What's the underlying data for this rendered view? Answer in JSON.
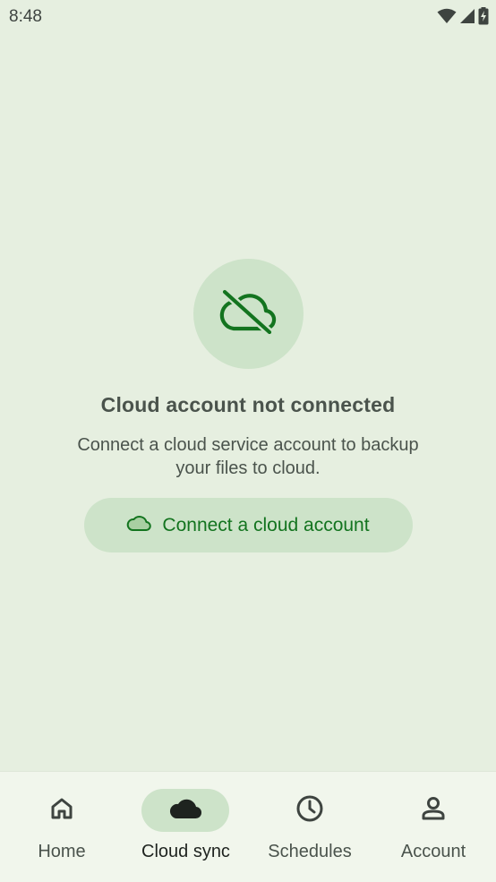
{
  "status_bar": {
    "time": "8:48",
    "icons": [
      "wifi-icon",
      "signal-icon",
      "battery-charging-icon"
    ]
  },
  "empty_state": {
    "icon": "cloud-off-icon",
    "title": "Cloud account not connected",
    "description": "Connect a cloud service account to backup your files to cloud.",
    "button_icon": "cloud-icon",
    "button_label": "Connect a cloud account"
  },
  "bottom_nav": {
    "items": [
      {
        "label": "Home",
        "icon": "home-icon",
        "active": false
      },
      {
        "label": "Cloud sync",
        "icon": "cloud-icon",
        "active": true
      },
      {
        "label": "Schedules",
        "icon": "clock-icon",
        "active": false
      },
      {
        "label": "Account",
        "icon": "person-icon",
        "active": false
      }
    ]
  },
  "colors": {
    "background": "#e6efe0",
    "accent": "#13741f",
    "tonal_container": "#cde3c9",
    "nav_background": "#f1f6ec"
  }
}
